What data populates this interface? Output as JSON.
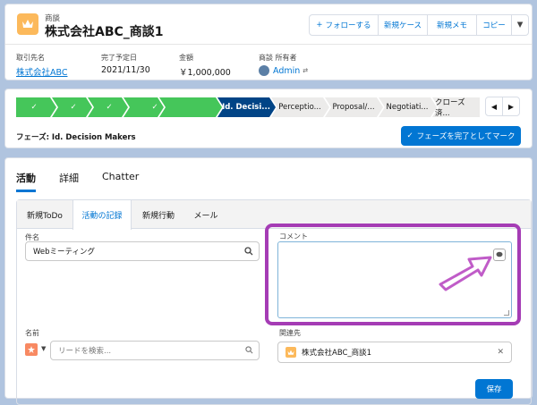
{
  "header": {
    "record_type": "商談",
    "title": "株式会社ABC_商談1",
    "buttons": {
      "follow": "フォローする",
      "new_case": "新規ケース",
      "new_memo": "新規メモ",
      "copy": "コピー"
    },
    "fields": [
      {
        "label": "取引先名",
        "value": "株式会社ABC"
      },
      {
        "label": "完了予定日",
        "value": "2021/11/30"
      },
      {
        "label": "金額",
        "value": "￥1,000,000"
      },
      {
        "label": "商談 所有者",
        "value": "Admin"
      }
    ]
  },
  "path": {
    "stages": [
      {
        "label": "✓",
        "state": "done"
      },
      {
        "label": "✓",
        "state": "done"
      },
      {
        "label": "✓",
        "state": "done"
      },
      {
        "label": "✓",
        "state": "done"
      },
      {
        "label": "Id. Decisi...",
        "state": "current"
      },
      {
        "label": "Perceptio...",
        "state": "todo"
      },
      {
        "label": "Proposal/...",
        "state": "todo"
      },
      {
        "label": "Negotiati...",
        "state": "todo"
      },
      {
        "label": "クローズ済...",
        "state": "todo"
      }
    ],
    "phase_label": "フェーズ: Id. Decision Makers",
    "mark_button": "フェーズを完了としてマーク"
  },
  "activity": {
    "tabs": [
      "活動",
      "詳細",
      "Chatter"
    ],
    "sub_tabs": [
      "新規ToDo",
      "活動の記録",
      "新規行動",
      "メール"
    ],
    "subject_label": "件名",
    "subject_value": "Webミーティング",
    "comment_label": "コメント",
    "name_label": "名前",
    "name_placeholder": "リードを検索...",
    "related_label": "関連先",
    "related_value": "株式会社ABC_商談1",
    "save_button": "保存"
  },
  "colors": {
    "accent": "#0176d3",
    "done": "#45c65a",
    "current": "#014486",
    "highlight": "#a53cb5",
    "arrow": "#c05cc8"
  }
}
